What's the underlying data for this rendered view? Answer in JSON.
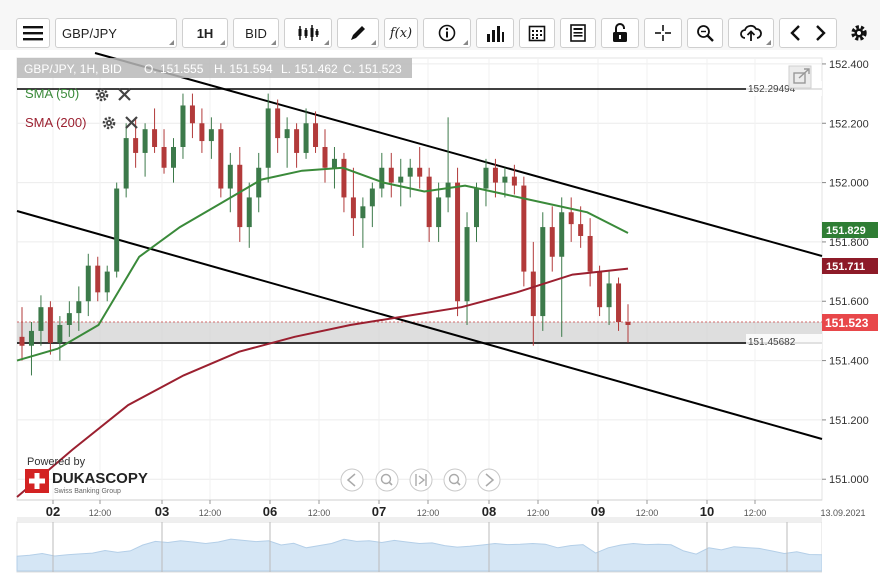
{
  "toolbar": {
    "symbol": "GBP/JPY",
    "period": "1H",
    "side": "BID",
    "icons": [
      "menu-icon",
      "candles-icon",
      "pencil-icon",
      "function-icon",
      "info-icon",
      "bars-icon",
      "calendar-icon",
      "report-icon",
      "lock-icon",
      "crosshair-icon",
      "zoom-icon",
      "upload-cloud-icon",
      "chevron-left-icon",
      "chevron-right-icon",
      "gear-icon"
    ],
    "function_label": "f(x)"
  },
  "header": {
    "title": "GBP/JPY, 1H, BID",
    "open": "O. 151.555",
    "high": "H. 151.594",
    "low": "L. 151.462",
    "close": "C. 151.523"
  },
  "indicators": [
    {
      "label": "SMA (50)",
      "color": "#3a8a3a"
    },
    {
      "label": "SMA (200)",
      "color": "#9b2030"
    }
  ],
  "price_labels": {
    "sma50": "151.829",
    "sma200": "151.711",
    "current": "151.523",
    "hline_top": "152.29494",
    "hline_bottom": "151.45682"
  },
  "branding": {
    "powered_by": "Powered by",
    "logo_text": "DUKASCOPY",
    "tagline": "Swiss Banking Group"
  },
  "colors": {
    "bull": "#3c7a4a",
    "bear": "#b23a3a",
    "sma50": "#3a8a3a",
    "sma200": "#9b2030",
    "band": "#d6d6d6"
  },
  "chart_data": {
    "type": "candlestick",
    "symbol": "GBP/JPY",
    "timeframe": "1H",
    "y_axis_ticks": [
      "152.400",
      "152.200",
      "152.000",
      "151.800",
      "151.600",
      "151.400",
      "151.200",
      "151.000"
    ],
    "ylim": [
      150.93,
      152.42
    ],
    "x_axis_labels": [
      "02",
      "12:00",
      "03",
      "12:00",
      "06",
      "12:00",
      "07",
      "12:00",
      "08",
      "12:00",
      "09",
      "12:00",
      "10",
      "12:00",
      "13.09.2021"
    ],
    "horizontal_lines": [
      152.29494,
      151.45682
    ],
    "shaded_zone": [
      151.452,
      151.523
    ],
    "current_price": 151.523,
    "sma50_last": 151.829,
    "sma200_last": 151.711,
    "sma50_curve": [
      151.4,
      151.44,
      151.52,
      151.75,
      151.85,
      151.93,
      152.01,
      152.04,
      152.05,
      152.0,
      151.97,
      151.99,
      151.96,
      151.93,
      151.9,
      151.83
    ],
    "sma200_curve": [
      150.94,
      151.1,
      151.25,
      151.35,
      151.43,
      151.48,
      151.52,
      151.55,
      151.58,
      151.63,
      151.69,
      151.71
    ],
    "trendlines": [
      {
        "name": "upper",
        "from": [
          0,
          152.42
        ],
        "to": [
          1,
          151.74
        ]
      },
      {
        "name": "lower",
        "from": [
          0,
          151.89
        ],
        "to": [
          1,
          151.13
        ]
      }
    ],
    "candles": [
      [
        151.48,
        151.58,
        151.4,
        151.45
      ],
      [
        151.45,
        151.53,
        151.35,
        151.5
      ],
      [
        151.5,
        151.62,
        151.45,
        151.58
      ],
      [
        151.58,
        151.6,
        151.42,
        151.46
      ],
      [
        151.46,
        151.55,
        151.4,
        151.52
      ],
      [
        151.52,
        151.6,
        151.48,
        151.56
      ],
      [
        151.56,
        151.65,
        151.5,
        151.6
      ],
      [
        151.6,
        151.76,
        151.55,
        151.72
      ],
      [
        151.72,
        151.75,
        151.6,
        151.63
      ],
      [
        151.63,
        151.72,
        151.6,
        151.7
      ],
      [
        151.7,
        152.0,
        151.68,
        151.98
      ],
      [
        151.98,
        152.2,
        151.95,
        152.15
      ],
      [
        152.15,
        152.22,
        152.05,
        152.1
      ],
      [
        152.1,
        152.2,
        152.02,
        152.18
      ],
      [
        152.18,
        152.25,
        152.1,
        152.12
      ],
      [
        152.12,
        152.18,
        152.03,
        152.05
      ],
      [
        152.05,
        152.15,
        152.0,
        152.12
      ],
      [
        152.12,
        152.3,
        152.08,
        152.26
      ],
      [
        152.26,
        152.3,
        152.15,
        152.2
      ],
      [
        152.2,
        152.25,
        152.1,
        152.14
      ],
      [
        152.14,
        152.22,
        152.08,
        152.18
      ],
      [
        152.18,
        152.2,
        151.95,
        151.98
      ],
      [
        151.98,
        152.1,
        151.9,
        152.06
      ],
      [
        152.06,
        152.12,
        151.8,
        151.85
      ],
      [
        151.85,
        152.0,
        151.78,
        151.95
      ],
      [
        151.95,
        152.1,
        151.9,
        152.05
      ],
      [
        152.05,
        152.3,
        152.0,
        152.25
      ],
      [
        152.25,
        152.28,
        152.1,
        152.15
      ],
      [
        152.15,
        152.22,
        152.05,
        152.18
      ],
      [
        152.18,
        152.2,
        152.05,
        152.1
      ],
      [
        152.1,
        152.25,
        152.08,
        152.2
      ],
      [
        152.2,
        152.24,
        152.1,
        152.12
      ],
      [
        152.12,
        152.18,
        152.0,
        152.05
      ],
      [
        152.05,
        152.12,
        151.98,
        152.08
      ],
      [
        152.08,
        152.1,
        151.9,
        151.95
      ],
      [
        151.95,
        152.05,
        151.82,
        151.88
      ],
      [
        151.88,
        151.95,
        151.78,
        151.92
      ],
      [
        151.92,
        152.0,
        151.85,
        151.98
      ],
      [
        151.98,
        152.1,
        151.95,
        152.05
      ],
      [
        152.05,
        152.1,
        151.95,
        152.0
      ],
      [
        152.0,
        152.08,
        151.92,
        152.02
      ],
      [
        152.02,
        152.08,
        151.95,
        152.05
      ],
      [
        152.05,
        152.12,
        151.98,
        152.02
      ],
      [
        152.02,
        152.05,
        151.8,
        151.85
      ],
      [
        151.85,
        152.0,
        151.8,
        151.95
      ],
      [
        151.95,
        152.22,
        151.9,
        152.0
      ],
      [
        152.0,
        152.05,
        151.55,
        151.6
      ],
      [
        151.6,
        151.9,
        151.52,
        151.85
      ],
      [
        151.85,
        152.0,
        151.8,
        151.98
      ],
      [
        151.98,
        152.08,
        151.92,
        152.05
      ],
      [
        152.05,
        152.08,
        151.95,
        152.0
      ],
      [
        152.0,
        152.05,
        151.95,
        152.02
      ],
      [
        152.02,
        152.06,
        151.96,
        151.99
      ],
      [
        151.99,
        152.02,
        151.65,
        151.7
      ],
      [
        151.7,
        151.8,
        151.45,
        151.55
      ],
      [
        151.55,
        151.9,
        151.5,
        151.85
      ],
      [
        151.85,
        151.92,
        151.7,
        151.75
      ],
      [
        151.75,
        151.95,
        151.48,
        151.9
      ],
      [
        151.9,
        151.95,
        151.8,
        151.86
      ],
      [
        151.86,
        151.92,
        151.78,
        151.82
      ],
      [
        151.82,
        151.88,
        151.65,
        151.7
      ],
      [
        151.7,
        151.72,
        151.55,
        151.58
      ],
      [
        151.58,
        151.7,
        151.52,
        151.66
      ],
      [
        151.66,
        151.68,
        151.5,
        151.53
      ],
      [
        151.53,
        151.59,
        151.46,
        151.52
      ]
    ]
  }
}
